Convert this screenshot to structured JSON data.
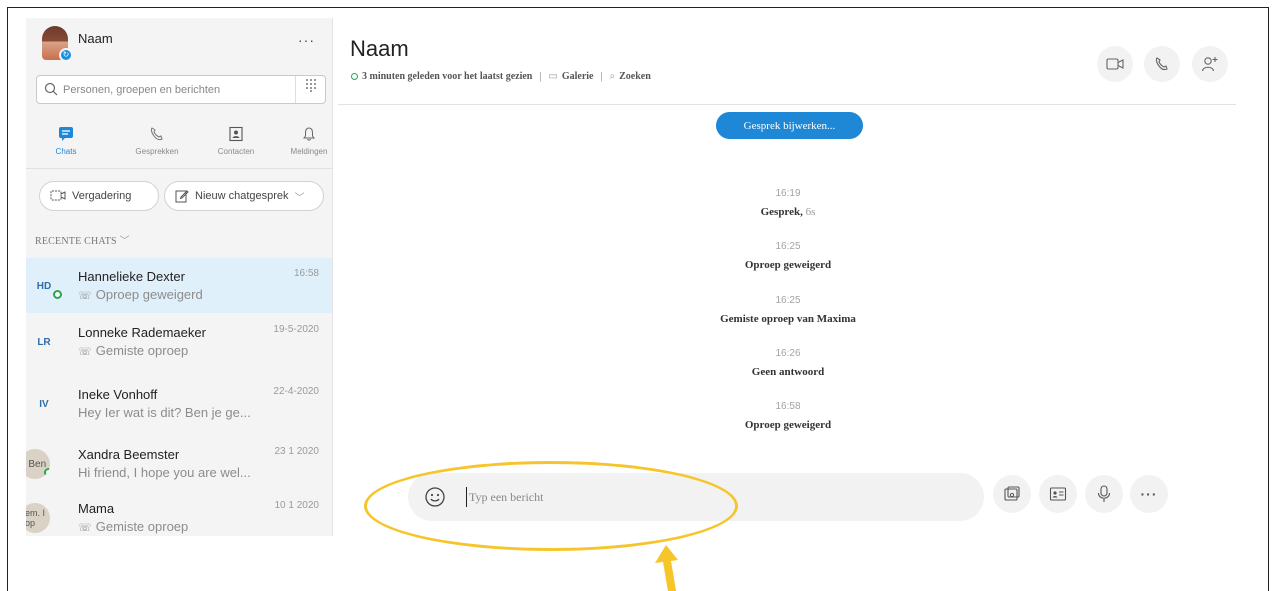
{
  "profile": {
    "name": "Naam",
    "more": "···"
  },
  "search": {
    "placeholder": "Personen, groepen en berichten"
  },
  "nav": [
    {
      "label": "Chats",
      "icon": "chat-icon",
      "active": true
    },
    {
      "label": "Gesprekken",
      "icon": "phone-icon"
    },
    {
      "label": "Contacten",
      "icon": "contacts-icon"
    },
    {
      "label": "Meldingen",
      "icon": "bell-icon"
    }
  ],
  "actions": {
    "meeting": "Vergadering",
    "new_chat": "Nieuw chatgesprek"
  },
  "recent_header": "RECENTE CHATS",
  "chats": [
    {
      "initials": "HD",
      "name": "Hannelieke Dexter",
      "time": "16:58",
      "preview": "Oproep geweigerd",
      "preview_icon": "phone-icon",
      "online": true,
      "active": true
    },
    {
      "initials": "LR",
      "name": "Lonneke Rademaeker",
      "time": "19-5-2020",
      "preview": "Gemiste oproep",
      "preview_icon": "phone-icon"
    },
    {
      "initials": "IV",
      "name": "Ineke Vonhoff",
      "time": "22-4-2020",
      "preview": "Hey Ier wat is dit? Ben je ge..."
    },
    {
      "initials": "? Ben",
      "name": "Xandra Beemster",
      "time": "23 1 2020",
      "preview": "Hi friend, I hope you are wel...",
      "online": true
    },
    {
      "initials": "eem. I hop",
      "name": "Mama",
      "time": "10 1 2020",
      "preview": "Gemiste oproep",
      "preview_icon": "phone-icon"
    }
  ],
  "conversation": {
    "title": "Naam",
    "last_seen": "3 minuten geleden voor het laatst gezien",
    "gallery": "Galerie",
    "search": "Zoeken",
    "update_button": "Gesprek bijwerken...",
    "events": [
      {
        "time": "16:19",
        "text": "Gesprek",
        "extra": "6s"
      },
      {
        "time": "16:25",
        "text": "Oproep geweigerd"
      },
      {
        "time": "16:25",
        "text": "Gemiste oproep van  Maxima"
      },
      {
        "time": "16:26",
        "text": "Geen antwoord"
      },
      {
        "time": "16:58",
        "text": "Oproep geweigerd"
      }
    ]
  },
  "composer": {
    "placeholder": "Typ een bericht"
  },
  "colors": {
    "accent": "#1e88d6",
    "highlight": "#f5c52a",
    "online": "#2ea44f"
  }
}
